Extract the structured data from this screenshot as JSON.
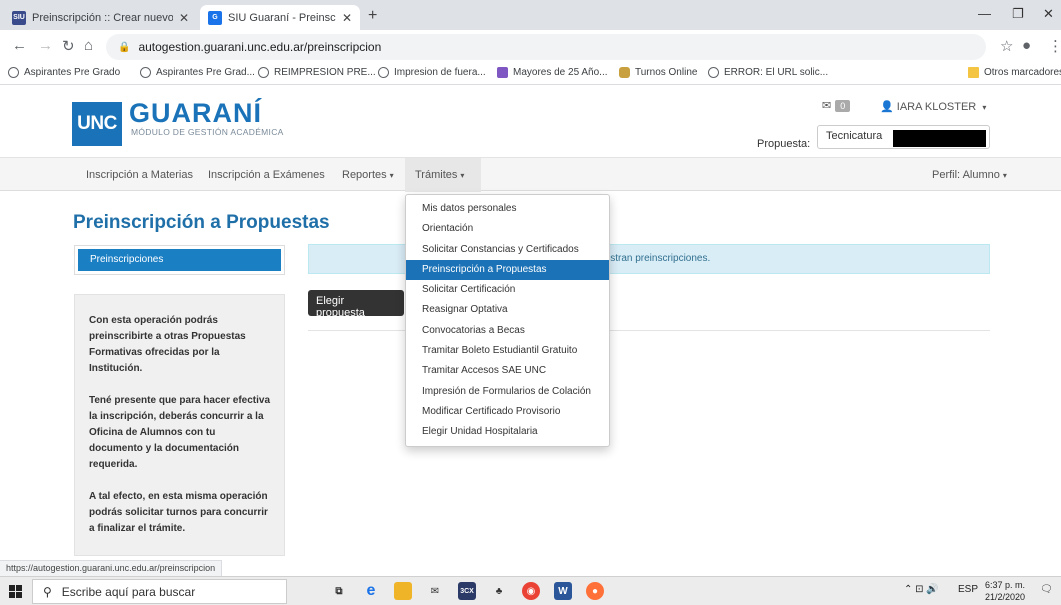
{
  "browser": {
    "tabs": [
      {
        "label": "Preinscripción :: Crear nuevo usu",
        "favicon": "SIU"
      },
      {
        "label": "SIU Guaraní - Preinscripción a Pr",
        "favicon": "G"
      }
    ],
    "url": "autogestion.guarani.unc.edu.ar/preinscripcion",
    "bookmarks": [
      "Aspirantes Pre Grado",
      "Aspirantes Pre Grad...",
      "REIMPRESION PRE...",
      "Impresion de fuera...",
      "Mayores de 25 Año...",
      "Turnos Online",
      "ERROR: El URL solic...",
      "Otros marcadores"
    ],
    "status_url": "https://autogestion.guarani.unc.edu.ar/preinscripcion"
  },
  "site": {
    "logo_unc": "UNC",
    "logo_guarani": "GUARANÍ",
    "logo_sub": "MÓDULO DE GESTIÓN ACADÉMICA",
    "messages_count": "0",
    "user_name": "IARA KLOSTER",
    "propuesta_label": "Propuesta:",
    "propuesta_value": "Tecnicatura"
  },
  "nav": {
    "items": [
      "Inscripción a Materias",
      "Inscripción a Exámenes",
      "Reportes",
      "Trámites"
    ],
    "perfil": "Perfil: Alumno"
  },
  "dropdown": {
    "items": [
      "Mis datos personales",
      "Orientación",
      "Solicitar Constancias y Certificados",
      "Preinscripción a Propuestas",
      "Solicitar Certificación",
      "Reasignar Optativa",
      "Convocatorias a Becas",
      "Tramitar Boleto Estudiantil Gratuito",
      "Tramitar Accesos SAE UNC",
      "Impresión de Formularios de Colación",
      "Modificar Certificado Provisorio",
      "Elegir Unidad Hospitalaria"
    ],
    "active_index": 3
  },
  "main": {
    "title": "Preinscripción a Propuestas",
    "side_tab": "Preinscripciones",
    "info_paragraphs": [
      "Con esta operación podrás preinscribirte a otras Propuestas Formativas ofrecidas por la Institución.",
      "Tené presente que para hacer efectiva la inscripción, deberás concurrir a la Oficina de Alumnos con tu documento y la documentación requerida.",
      "A tal efecto, en esta misma operación podrás solicitar turnos para concurrir a finalizar el trámite."
    ],
    "alert_text": "istran preinscripciones.",
    "button_label": "Elegir propuesta"
  },
  "taskbar": {
    "search_placeholder": "Escribe aquí para buscar",
    "lang": "ESP",
    "time": "6:37 p. m.",
    "date": "21/2/2020"
  },
  "colors": {
    "brand_blue": "#1a73b8",
    "active_item": "#1b72b6",
    "alert_bg": "#d9edf7"
  }
}
